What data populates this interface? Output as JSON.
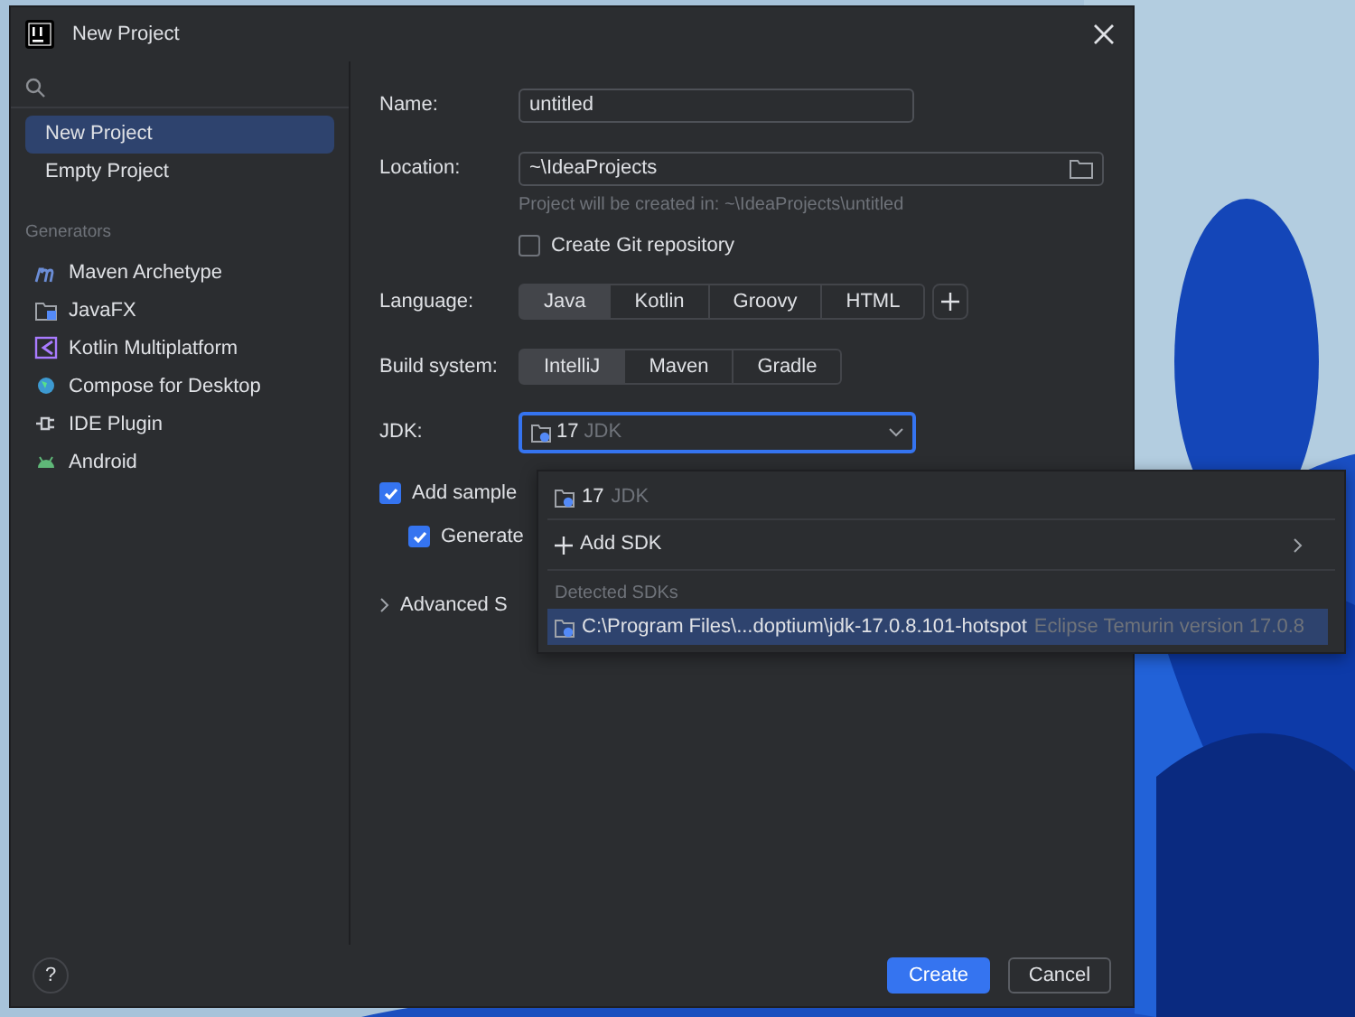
{
  "window": {
    "title": "New Project"
  },
  "sidebar": {
    "items": [
      {
        "label": "New Project",
        "selected": true
      },
      {
        "label": "Empty Project",
        "selected": false
      }
    ],
    "section": "Generators",
    "generators": [
      {
        "label": "Maven Archetype"
      },
      {
        "label": "JavaFX"
      },
      {
        "label": "Kotlin Multiplatform"
      },
      {
        "label": "Compose for Desktop"
      },
      {
        "label": "IDE Plugin"
      },
      {
        "label": "Android"
      }
    ]
  },
  "form": {
    "name": {
      "label": "Name:",
      "value": "untitled"
    },
    "location": {
      "label": "Location:",
      "value": "~\\IdeaProjects",
      "hint": "Project will be created in: ~\\IdeaProjects\\untitled"
    },
    "git": {
      "label": "Create Git repository",
      "checked": false
    },
    "language": {
      "label": "Language:",
      "options": [
        {
          "label": "Java",
          "selected": true
        },
        {
          "label": "Kotlin",
          "selected": false
        },
        {
          "label": "Groovy",
          "selected": false
        },
        {
          "label": "HTML",
          "selected": false
        }
      ]
    },
    "build_system": {
      "label": "Build system:",
      "options": [
        {
          "label": "IntelliJ",
          "selected": true
        },
        {
          "label": "Maven",
          "selected": false
        },
        {
          "label": "Gradle",
          "selected": false
        }
      ]
    },
    "jdk": {
      "label": "JDK:",
      "version": "17",
      "detail": "JDK",
      "expanded": true
    },
    "sample_code": {
      "label": "Add sample",
      "checked": true
    },
    "generate": {
      "label": "Generate",
      "checked": true
    },
    "advanced": {
      "label": "Advanced S",
      "expanded": false
    }
  },
  "popup": {
    "items": [
      {
        "kind": "sdk",
        "version": "17",
        "detail": "JDK",
        "selected": false
      },
      {
        "kind": "action",
        "label": "Add SDK",
        "selected": false
      }
    ],
    "section": "Detected SDKs",
    "detected": [
      {
        "path": "C:\\Program Files\\...doptium\\jdk-17.0.8.101-hotspot",
        "detail": "Eclipse Temurin version 17.0.8",
        "selected": true
      }
    ]
  },
  "footer": {
    "help": "?",
    "buttons": [
      {
        "label": "Create",
        "kind": "primary"
      },
      {
        "label": "Cancel",
        "kind": "secondary"
      }
    ]
  }
}
